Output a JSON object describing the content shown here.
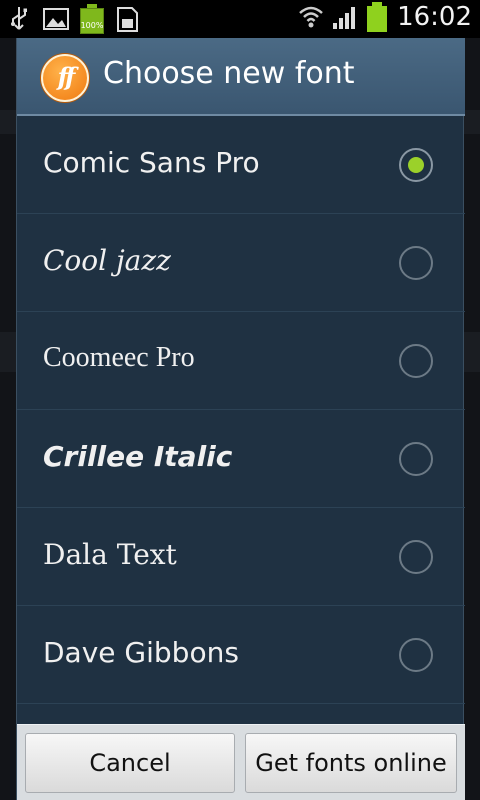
{
  "status_bar": {
    "icons_left": [
      "usb-icon",
      "image-icon",
      "battery-full-icon",
      "sd-card-icon"
    ],
    "battery_left_label": "100%",
    "icons_right": [
      "wifi-icon",
      "signal-icon",
      "battery-icon"
    ],
    "time": "16:02"
  },
  "dialog": {
    "title": "Choose new font",
    "logo_text": "ff",
    "fonts": [
      {
        "label": "Comic Sans Pro",
        "selected": true
      },
      {
        "label": "Cool jazz",
        "selected": false
      },
      {
        "label": "Coomeec Pro",
        "selected": false
      },
      {
        "label": "Crillee Italic",
        "selected": false
      },
      {
        "label": "Dala Text",
        "selected": false
      },
      {
        "label": "Dave Gibbons",
        "selected": false
      }
    ],
    "cancel_label": "Cancel",
    "get_fonts_label": "Get fonts online"
  },
  "colors": {
    "accent_green": "#9bd12a",
    "header": "#3a5670",
    "list_bg": "#1f3142"
  }
}
